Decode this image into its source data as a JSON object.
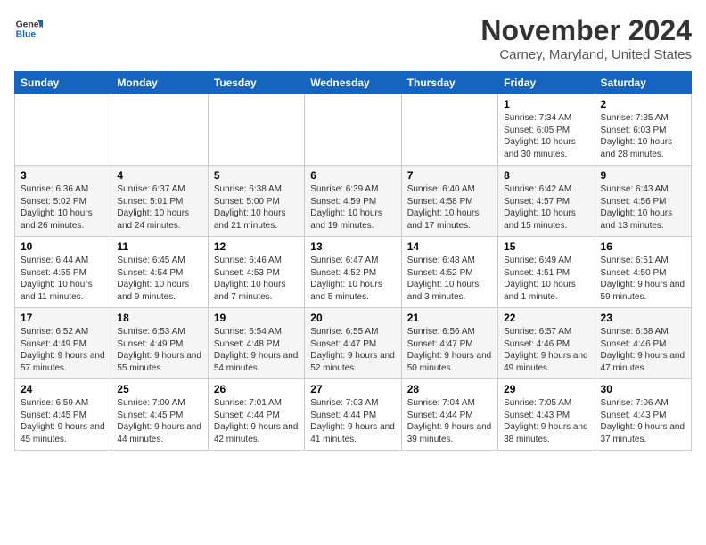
{
  "header": {
    "logo_line1": "General",
    "logo_line2": "Blue",
    "month_year": "November 2024",
    "location": "Carney, Maryland, United States"
  },
  "days_of_week": [
    "Sunday",
    "Monday",
    "Tuesday",
    "Wednesday",
    "Thursday",
    "Friday",
    "Saturday"
  ],
  "weeks": [
    [
      {
        "day": "",
        "info": ""
      },
      {
        "day": "",
        "info": ""
      },
      {
        "day": "",
        "info": ""
      },
      {
        "day": "",
        "info": ""
      },
      {
        "day": "",
        "info": ""
      },
      {
        "day": "1",
        "info": "Sunrise: 7:34 AM\nSunset: 6:05 PM\nDaylight: 10 hours and 30 minutes."
      },
      {
        "day": "2",
        "info": "Sunrise: 7:35 AM\nSunset: 6:03 PM\nDaylight: 10 hours and 28 minutes."
      }
    ],
    [
      {
        "day": "3",
        "info": "Sunrise: 6:36 AM\nSunset: 5:02 PM\nDaylight: 10 hours and 26 minutes."
      },
      {
        "day": "4",
        "info": "Sunrise: 6:37 AM\nSunset: 5:01 PM\nDaylight: 10 hours and 24 minutes."
      },
      {
        "day": "5",
        "info": "Sunrise: 6:38 AM\nSunset: 5:00 PM\nDaylight: 10 hours and 21 minutes."
      },
      {
        "day": "6",
        "info": "Sunrise: 6:39 AM\nSunset: 4:59 PM\nDaylight: 10 hours and 19 minutes."
      },
      {
        "day": "7",
        "info": "Sunrise: 6:40 AM\nSunset: 4:58 PM\nDaylight: 10 hours and 17 minutes."
      },
      {
        "day": "8",
        "info": "Sunrise: 6:42 AM\nSunset: 4:57 PM\nDaylight: 10 hours and 15 minutes."
      },
      {
        "day": "9",
        "info": "Sunrise: 6:43 AM\nSunset: 4:56 PM\nDaylight: 10 hours and 13 minutes."
      }
    ],
    [
      {
        "day": "10",
        "info": "Sunrise: 6:44 AM\nSunset: 4:55 PM\nDaylight: 10 hours and 11 minutes."
      },
      {
        "day": "11",
        "info": "Sunrise: 6:45 AM\nSunset: 4:54 PM\nDaylight: 10 hours and 9 minutes."
      },
      {
        "day": "12",
        "info": "Sunrise: 6:46 AM\nSunset: 4:53 PM\nDaylight: 10 hours and 7 minutes."
      },
      {
        "day": "13",
        "info": "Sunrise: 6:47 AM\nSunset: 4:52 PM\nDaylight: 10 hours and 5 minutes."
      },
      {
        "day": "14",
        "info": "Sunrise: 6:48 AM\nSunset: 4:52 PM\nDaylight: 10 hours and 3 minutes."
      },
      {
        "day": "15",
        "info": "Sunrise: 6:49 AM\nSunset: 4:51 PM\nDaylight: 10 hours and 1 minute."
      },
      {
        "day": "16",
        "info": "Sunrise: 6:51 AM\nSunset: 4:50 PM\nDaylight: 9 hours and 59 minutes."
      }
    ],
    [
      {
        "day": "17",
        "info": "Sunrise: 6:52 AM\nSunset: 4:49 PM\nDaylight: 9 hours and 57 minutes."
      },
      {
        "day": "18",
        "info": "Sunrise: 6:53 AM\nSunset: 4:49 PM\nDaylight: 9 hours and 55 minutes."
      },
      {
        "day": "19",
        "info": "Sunrise: 6:54 AM\nSunset: 4:48 PM\nDaylight: 9 hours and 54 minutes."
      },
      {
        "day": "20",
        "info": "Sunrise: 6:55 AM\nSunset: 4:47 PM\nDaylight: 9 hours and 52 minutes."
      },
      {
        "day": "21",
        "info": "Sunrise: 6:56 AM\nSunset: 4:47 PM\nDaylight: 9 hours and 50 minutes."
      },
      {
        "day": "22",
        "info": "Sunrise: 6:57 AM\nSunset: 4:46 PM\nDaylight: 9 hours and 49 minutes."
      },
      {
        "day": "23",
        "info": "Sunrise: 6:58 AM\nSunset: 4:46 PM\nDaylight: 9 hours and 47 minutes."
      }
    ],
    [
      {
        "day": "24",
        "info": "Sunrise: 6:59 AM\nSunset: 4:45 PM\nDaylight: 9 hours and 45 minutes."
      },
      {
        "day": "25",
        "info": "Sunrise: 7:00 AM\nSunset: 4:45 PM\nDaylight: 9 hours and 44 minutes."
      },
      {
        "day": "26",
        "info": "Sunrise: 7:01 AM\nSunset: 4:44 PM\nDaylight: 9 hours and 42 minutes."
      },
      {
        "day": "27",
        "info": "Sunrise: 7:03 AM\nSunset: 4:44 PM\nDaylight: 9 hours and 41 minutes."
      },
      {
        "day": "28",
        "info": "Sunrise: 7:04 AM\nSunset: 4:44 PM\nDaylight: 9 hours and 39 minutes."
      },
      {
        "day": "29",
        "info": "Sunrise: 7:05 AM\nSunset: 4:43 PM\nDaylight: 9 hours and 38 minutes."
      },
      {
        "day": "30",
        "info": "Sunrise: 7:06 AM\nSunset: 4:43 PM\nDaylight: 9 hours and 37 minutes."
      }
    ]
  ]
}
